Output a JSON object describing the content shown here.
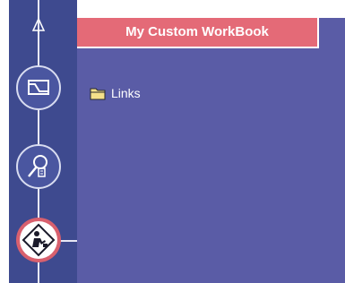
{
  "workbook": {
    "title": "My Custom WorkBook"
  },
  "tree": {
    "items": [
      {
        "label": "Links",
        "icon": "folder-icon"
      }
    ]
  },
  "toolbar": {
    "buttons": [
      {
        "name": "signal-graph-button",
        "icon": "signal-graph-icon"
      },
      {
        "name": "key-search-button",
        "icon": "key-search-icon"
      },
      {
        "name": "workbook-worker-button",
        "icon": "construction-worker-icon",
        "active": true
      }
    ]
  },
  "colors": {
    "rail": "#3e4a8f",
    "panel": "#5a5ca6",
    "header": "#e46a77",
    "active_badge": "#d8606e",
    "folder": "#f5e08a"
  }
}
